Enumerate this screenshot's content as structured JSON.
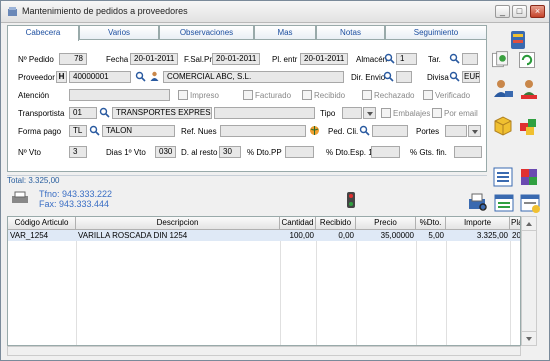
{
  "window": {
    "title": "Mantenimiento de pedidos a proveedores",
    "minimize": "_",
    "maximize": "□",
    "close": "×"
  },
  "tabs": [
    "Cabecera",
    "Varios",
    "Observaciones",
    "Mas",
    "Notas",
    "Seguimiento"
  ],
  "form": {
    "pedido_label": "Nº Pedido",
    "pedido": "78",
    "fecha_label": "Fecha",
    "fecha": "20-01-2011",
    "fsalpr_label": "F.Sal.Pr.",
    "fsalpr": "20-01-2011",
    "plentr_label": "Pl. entr",
    "plentr": "20-01-2011",
    "almacen_label": "Almacén",
    "almacen": "1",
    "tar_label": "Tar.",
    "tar": "",
    "proveedor_label": "Proveedor",
    "proveedor_h": "H",
    "proveedor": "40000001",
    "proveedor_name": "COMERCIAL ABC, S.L.",
    "direnvio_label": "Dir. Envio",
    "direnvio": "",
    "divisa_label": "Divisa",
    "divisa": "EUR",
    "atencion_label": "Atención",
    "atencion": "",
    "impreso": "Impreso",
    "facturado": "Facturado",
    "recibido": "Recibido",
    "rechazado": "Rechazado",
    "verificado": "Verificado",
    "transportista_label": "Transportista",
    "transportista_code": "01",
    "transportista": "TRANSPORTES EXPRESS",
    "tipo_label": "Tipo",
    "embalajes": "Embalajes",
    "poremail": "Por email",
    "formapago_label": "Forma pago",
    "formapago_code": "TL",
    "formapago": "TALON",
    "refnues_label": "Ref. Nues",
    "refnues": "",
    "pedcli_label": "Ped. Cli.",
    "pedcli": "",
    "portes_label": "Portes",
    "nvto_label": "Nº Vto",
    "nvto": "3",
    "dias1_label": "Dias 1º Vto",
    "dias1": "030",
    "dalresto_label": "D. al resto",
    "dalresto": "30",
    "dtopp_label": "% Dto.PP",
    "dtopp": "",
    "dtoesp_label": "% Dto.Esp. 1",
    "dtoesp": "",
    "gtsfin_label": "% Gts. fin.",
    "gtsfin": ""
  },
  "status": {
    "total": "Total: 3.325,00",
    "tfno": "Tfno: 943.333.222",
    "fax": "Fax: 943.333.444"
  },
  "grid": {
    "headers": [
      "Código Articulo",
      "Descripcion",
      "Cantidad",
      "Recibido",
      "Precio",
      "%Dto.",
      "Importe",
      "Pla"
    ],
    "rows": [
      [
        "VAR_1254",
        "VARILLA ROSCADA DIN 1254",
        "100,00",
        "0,00",
        "35,00000",
        "5,00",
        "3.325,00",
        "20"
      ]
    ]
  },
  "colors": {
    "accent": "#1d4fa0",
    "selected_row": "#dfe9f6",
    "status_text": "#2a5f9e"
  }
}
